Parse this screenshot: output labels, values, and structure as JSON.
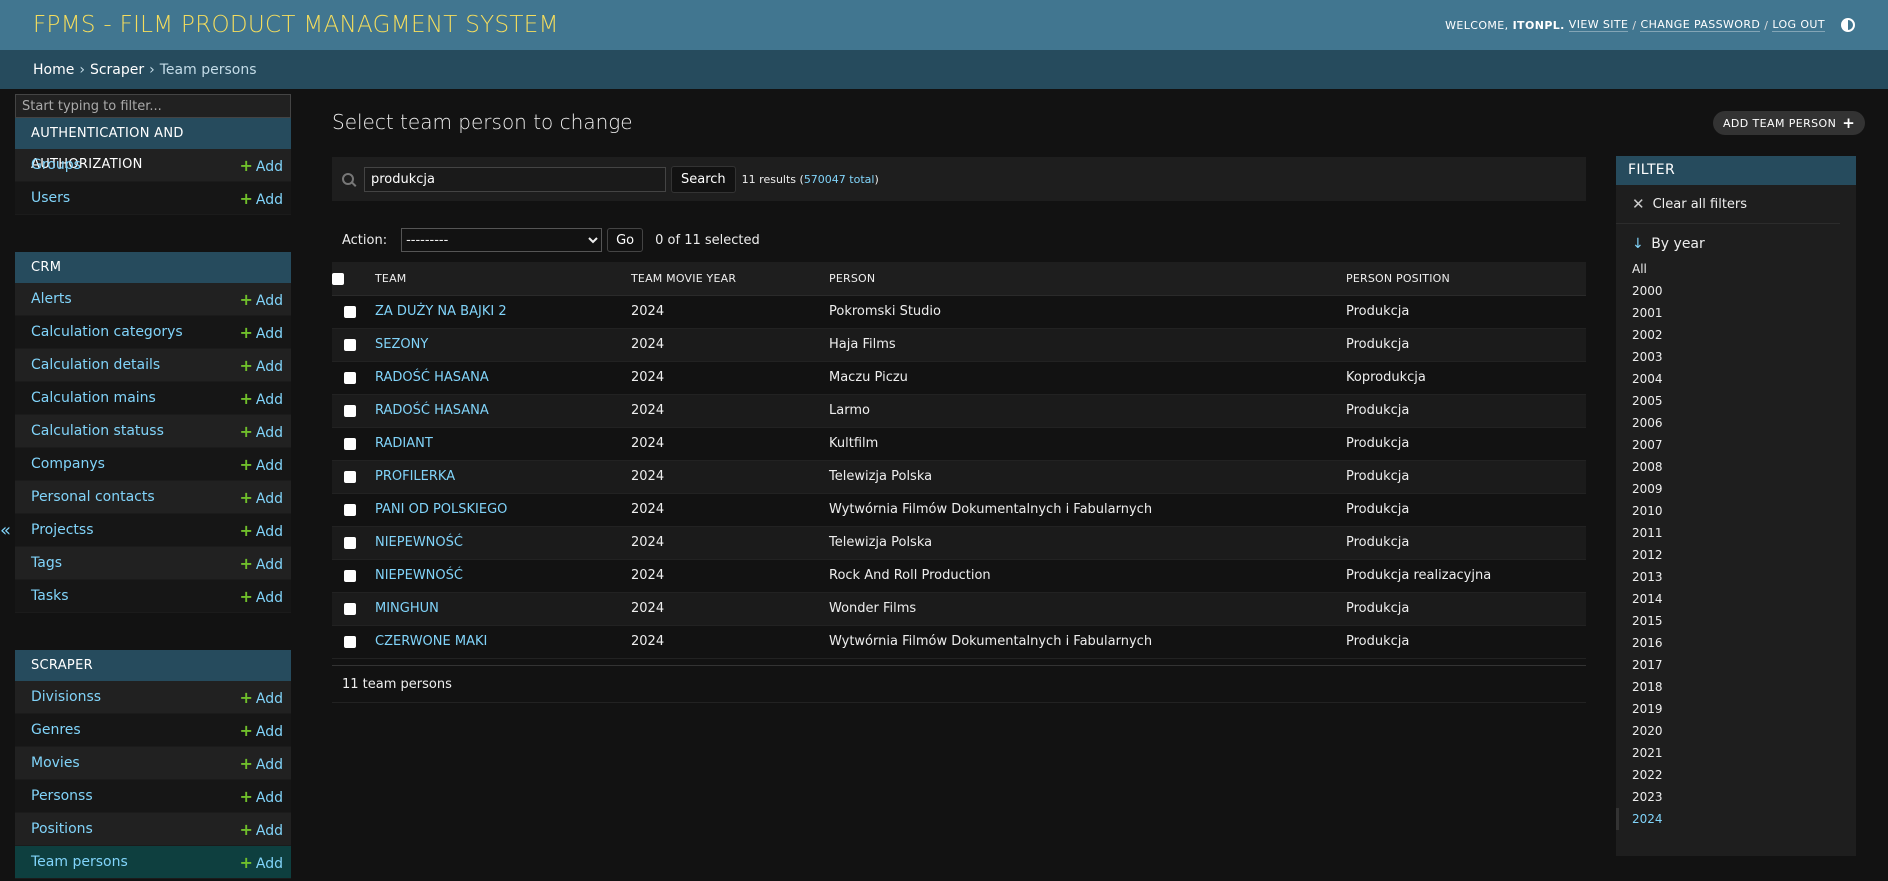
{
  "header": {
    "branding": "FPMS - FILM PRODUCT MANAGMENT SYSTEM",
    "welcome": "WELCOME,",
    "username": "ITONPL.",
    "view_site": "VIEW SITE",
    "change_password": "CHANGE PASSWORD",
    "log_out": "LOG OUT",
    "sep": "/"
  },
  "breadcrumbs": {
    "home": "Home",
    "app": "Scraper",
    "current": "Team persons",
    "sep": "›"
  },
  "sidebar": {
    "filter_placeholder": "Start typing to filter...",
    "collapse_icon": "«",
    "add_label": "Add",
    "apps": [
      {
        "caption": "AUTHENTICATION AND AUTHORIZATION",
        "models": [
          "Groups",
          "Users"
        ]
      },
      {
        "caption": "CRM",
        "models": [
          "Alerts",
          "Calculation categorys",
          "Calculation details",
          "Calculation mains",
          "Calculation statuss",
          "Companys",
          "Personal contacts",
          "Projectss",
          "Tags",
          "Tasks"
        ]
      },
      {
        "caption": "SCRAPER",
        "models": [
          "Divisionss",
          "Genres",
          "Movies",
          "Personss",
          "Positions",
          "Team persons"
        ]
      }
    ]
  },
  "main": {
    "title": "Select team person to change",
    "add_button": "ADD TEAM PERSON",
    "search": {
      "value": "produkcja",
      "button": "Search",
      "results_prefix": "11 results (",
      "total_link": "570047 total",
      "results_suffix": ")"
    },
    "actions": {
      "label": "Action:",
      "selected_option": "---------",
      "go": "Go",
      "selected_count": "0 of 11 selected"
    },
    "table": {
      "headers": [
        "TEAM",
        "TEAM MOVIE YEAR",
        "PERSON",
        "PERSON POSITION"
      ],
      "rows": [
        {
          "team": "ZA DUŻY NA BAJKI 2",
          "year": "2024",
          "person": "Pokromski Studio",
          "position": "Produkcja"
        },
        {
          "team": "SEZONY",
          "year": "2024",
          "person": "Haja Films",
          "position": "Produkcja"
        },
        {
          "team": "RADOŚĆ HASANA",
          "year": "2024",
          "person": "Maczu Piczu",
          "position": "Koprodukcja"
        },
        {
          "team": "RADOŚĆ HASANA",
          "year": "2024",
          "person": "Larmo",
          "position": "Produkcja"
        },
        {
          "team": "RADIANT",
          "year": "2024",
          "person": "Kultfilm",
          "position": "Produkcja"
        },
        {
          "team": "PROFILERKA",
          "year": "2024",
          "person": "Telewizja Polska",
          "position": "Produkcja"
        },
        {
          "team": "PANI OD POLSKIEGO",
          "year": "2024",
          "person": "Wytwórnia Filmów Dokumentalnych i Fabularnych",
          "position": "Produkcja"
        },
        {
          "team": "NIEPEWNOŚĆ",
          "year": "2024",
          "person": "Telewizja Polska",
          "position": "Produkcja"
        },
        {
          "team": "NIEPEWNOŚĆ",
          "year": "2024",
          "person": "Rock And Roll Production",
          "position": "Produkcja realizacyjna"
        },
        {
          "team": "MINGHUN",
          "year": "2024",
          "person": "Wonder Films",
          "position": "Produkcja"
        },
        {
          "team": "CZERWONE MAKI",
          "year": "2024",
          "person": "Wytwórnia Filmów Dokumentalnych i Fabularnych",
          "position": "Produkcja"
        }
      ]
    },
    "paginator": "11 team persons"
  },
  "filter": {
    "title": "FILTER",
    "clear": "Clear all filters",
    "by_year": "By year",
    "options": [
      "All",
      "2000",
      "2001",
      "2002",
      "2003",
      "2004",
      "2005",
      "2006",
      "2007",
      "2008",
      "2009",
      "2010",
      "2011",
      "2012",
      "2013",
      "2014",
      "2015",
      "2016",
      "2017",
      "2018",
      "2019",
      "2020",
      "2021",
      "2022",
      "2023",
      "2024"
    ],
    "selected": "2024"
  },
  "colors": {
    "header_bg": "#417690",
    "branding": "#f5dd5d",
    "breadcrumb_bg": "#264b5d",
    "link": "#81d4fa",
    "add_plus": "#70bf2b",
    "current_row": "#0e3f3f"
  }
}
